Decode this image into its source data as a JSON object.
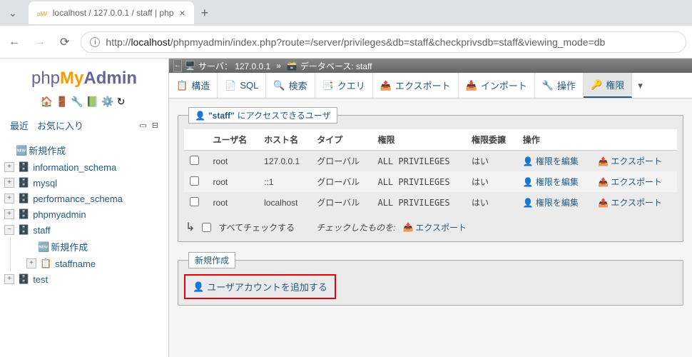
{
  "browser": {
    "tab_title": "localhost / 127.0.0.1 / staff | php",
    "new_tab": "+",
    "close": "×",
    "url_host": "localhost",
    "url_path": "/phpmyadmin/index.php?route=/server/privileges&db=staff&checkprivsdb=staff&viewing_mode=db",
    "url_prefix": "http://"
  },
  "logo": {
    "p1": "php",
    "p2": "My",
    "p3": "Admin"
  },
  "sidebar": {
    "fav_recent": "最近",
    "fav_fav": "お気に入り",
    "new_create": "新規作成",
    "dbs": [
      "information_schema",
      "mysql",
      "performance_schema",
      "phpmyadmin",
      "staff",
      "test"
    ],
    "staff_new": "新規作成",
    "staff_table": "staffname"
  },
  "breadcrumb": {
    "server_lbl": "サーバ：",
    "server_val": "127.0.0.1",
    "db_lbl": "データベース:",
    "db_val": "staff"
  },
  "tabs": {
    "structure": "構造",
    "sql": "SQL",
    "search": "検索",
    "query": "クエリ",
    "export": "エクスポート",
    "import": "インポート",
    "operations": "操作",
    "privileges": "権限"
  },
  "panel": {
    "legend_prefix": "\"staff\"",
    "legend_suffix": "にアクセスできるユーザ"
  },
  "table": {
    "headers": {
      "user": "ユーザ名",
      "host": "ホスト名",
      "type": "タイプ",
      "priv": "権限",
      "grant": "権限委譲",
      "action": "操作"
    },
    "rows": [
      {
        "user": "root",
        "host": "127.0.0.1",
        "type": "グローバル",
        "priv": "ALL PRIVILEGES",
        "grant": "はい"
      },
      {
        "user": "root",
        "host": "::1",
        "type": "グローバル",
        "priv": "ALL PRIVILEGES",
        "grant": "はい"
      },
      {
        "user": "root",
        "host": "localhost",
        "type": "グローバル",
        "priv": "ALL PRIVILEGES",
        "grant": "はい"
      }
    ],
    "edit_label": "権限を編集",
    "export_label": "エクスポート"
  },
  "checkall": {
    "label": "すべてチェックする",
    "with_selected": "チェックしたものを:",
    "export": "エクスポート"
  },
  "new_section": {
    "legend": "新規作成",
    "add_user": "ユーザアカウントを追加する"
  }
}
